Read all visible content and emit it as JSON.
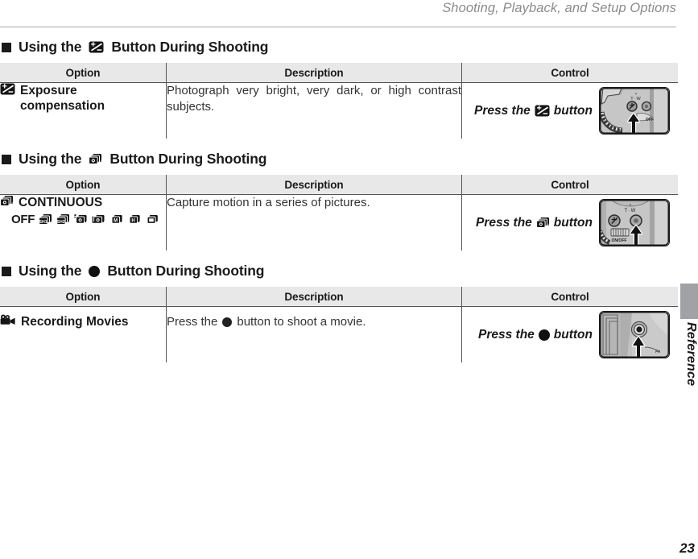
{
  "header": {
    "running_title": "Shooting, Playback, and Setup Options"
  },
  "sections": [
    {
      "heading_prefix": "Using the",
      "heading_icon": "exposure-compensation-icon",
      "heading_suffix": "Button During Shooting",
      "columns": {
        "option": "Option",
        "description": "Description",
        "control": "Control"
      },
      "rows": [
        {
          "option_icon": "exposure-compensation-icon",
          "option_line1": "Exposure",
          "option_line2": "compensation",
          "description": "Photograph very bright, very dark, or high contrast subjects.",
          "control_prefix": "Press the",
          "control_icon": "exposure-compensation-icon",
          "control_suffix": "button",
          "control_image": "camera-top-dial-exposure-button"
        }
      ]
    },
    {
      "heading_prefix": "Using the",
      "heading_icon": "continuous-shooting-icon",
      "heading_suffix": "Button During Shooting",
      "columns": {
        "option": "Option",
        "description": "Description",
        "control": "Control"
      },
      "rows": [
        {
          "option_icon": "continuous-shooting-icon",
          "option_line1": "CONTINUOUS",
          "drive_modes": [
            {
              "label": "OFF",
              "icon": "drive-off-label"
            },
            {
              "label": "SH1",
              "icon": "drive-sh1-icon"
            },
            {
              "label": "SH2",
              "icon": "drive-sh2-icon"
            },
            {
              "label": "H",
              "icon": "drive-continuous-high-icon"
            },
            {
              "label": "L",
              "icon": "drive-continuous-low-icon"
            },
            {
              "label": "M",
              "icon": "drive-continuous-m-icon"
            },
            {
              "label": "H2",
              "icon": "drive-continuous-h-icon"
            },
            {
              "label": "stack",
              "icon": "drive-continuous-stack-icon"
            }
          ],
          "description": "Capture motion in a series of pictures.",
          "control_prefix": "Press the",
          "control_icon": "continuous-shooting-icon",
          "control_suffix": "button",
          "control_image": "camera-top-dial-continuous-button"
        }
      ]
    },
    {
      "heading_prefix": "Using the",
      "heading_icon": "record-dot-icon",
      "heading_suffix": "Button During Shooting",
      "columns": {
        "option": "Option",
        "description": "Description",
        "control": "Control"
      },
      "rows": [
        {
          "option_icon": "movie-camera-icon",
          "option_line1": "Recording Movies",
          "description_prefix": "Press the",
          "description_icon": "record-dot-icon",
          "description_suffix": "button to shoot a movie.",
          "control_prefix": "Press the",
          "control_icon": "record-dot-icon",
          "control_suffix": "button",
          "control_image": "camera-rear-record-button"
        }
      ]
    }
  ],
  "sidebar": {
    "tab_label": "Reference"
  },
  "footer": {
    "page_number": "23"
  },
  "colors": {
    "header_text": "#8b8b8b",
    "rule": "#a8a8a8",
    "table_header_bg": "#e8e8e8",
    "table_border": "#555555",
    "tab_gray": "#a0a2a5",
    "body_text": "#1a1a1a"
  }
}
